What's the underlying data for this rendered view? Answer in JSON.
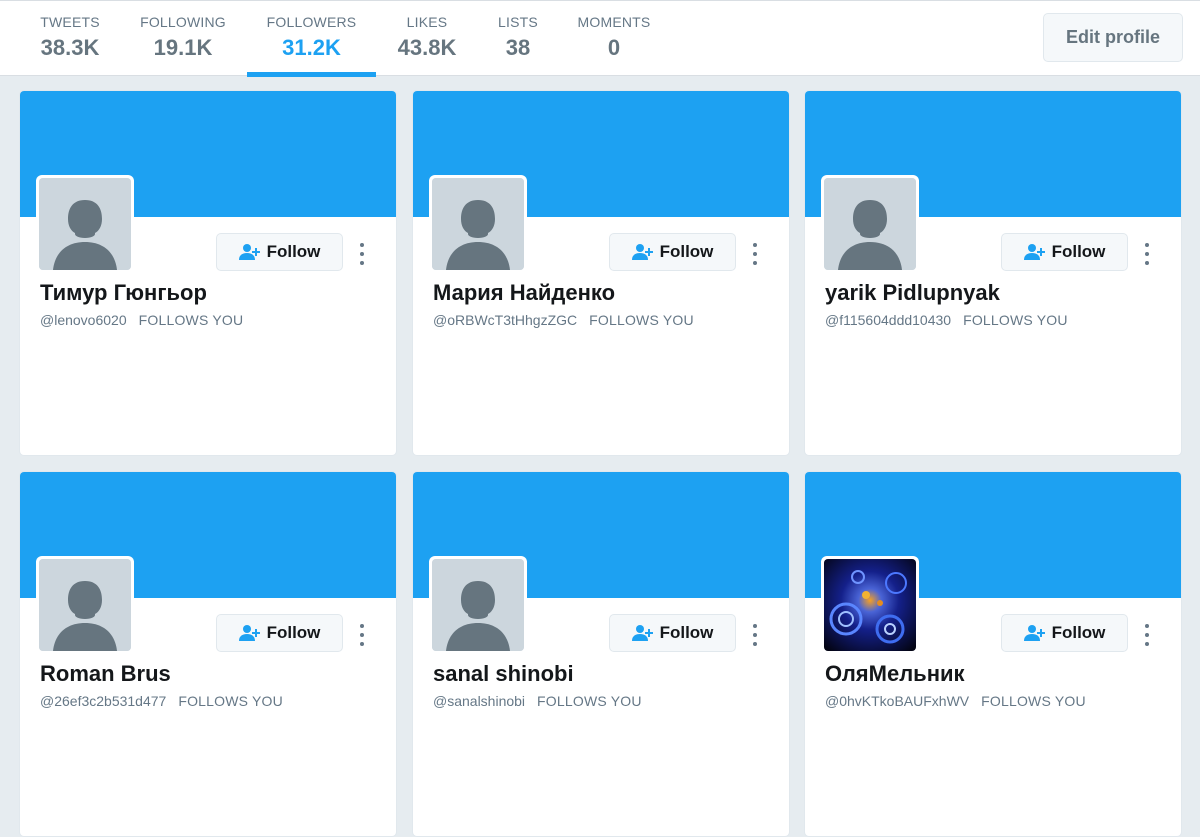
{
  "nav": [
    {
      "label": "TWEETS",
      "value": "38.3K",
      "active": false
    },
    {
      "label": "FOLLOWING",
      "value": "19.1K",
      "active": false
    },
    {
      "label": "FOLLOWERS",
      "value": "31.2K",
      "active": true
    },
    {
      "label": "LIKES",
      "value": "43.8K",
      "active": false
    },
    {
      "label": "LISTS",
      "value": "38",
      "active": false
    },
    {
      "label": "MOMENTS",
      "value": "0",
      "active": false
    }
  ],
  "edit_profile_label": "Edit profile",
  "follow_label": "Follow",
  "follows_you_label": "FOLLOWS YOU",
  "colors": {
    "accent": "#1da1f2",
    "background": "#e6ecf0"
  },
  "cards": [
    {
      "name": "Тимур Гюнгьор",
      "handle": "@lenovo6020",
      "avatar": "default-avatar-icon"
    },
    {
      "name": "Мария Найденко",
      "handle": "@oRBWcT3tHhgzZGC",
      "avatar": "default-avatar-icon"
    },
    {
      "name": "yarik Pidlupnyak",
      "handle": "@f115604ddd10430",
      "avatar": "default-avatar-icon"
    },
    {
      "name": "Roman Brus",
      "handle": "@26ef3c2b531d477",
      "avatar": "default-avatar-icon"
    },
    {
      "name": "sanal shinobi",
      "handle": "@sanalshinobi",
      "avatar": "default-avatar-icon"
    },
    {
      "name": "ОляМельник",
      "handle": "@0hvKTkoBAUFxhWV",
      "avatar": "fractal-photo"
    }
  ]
}
